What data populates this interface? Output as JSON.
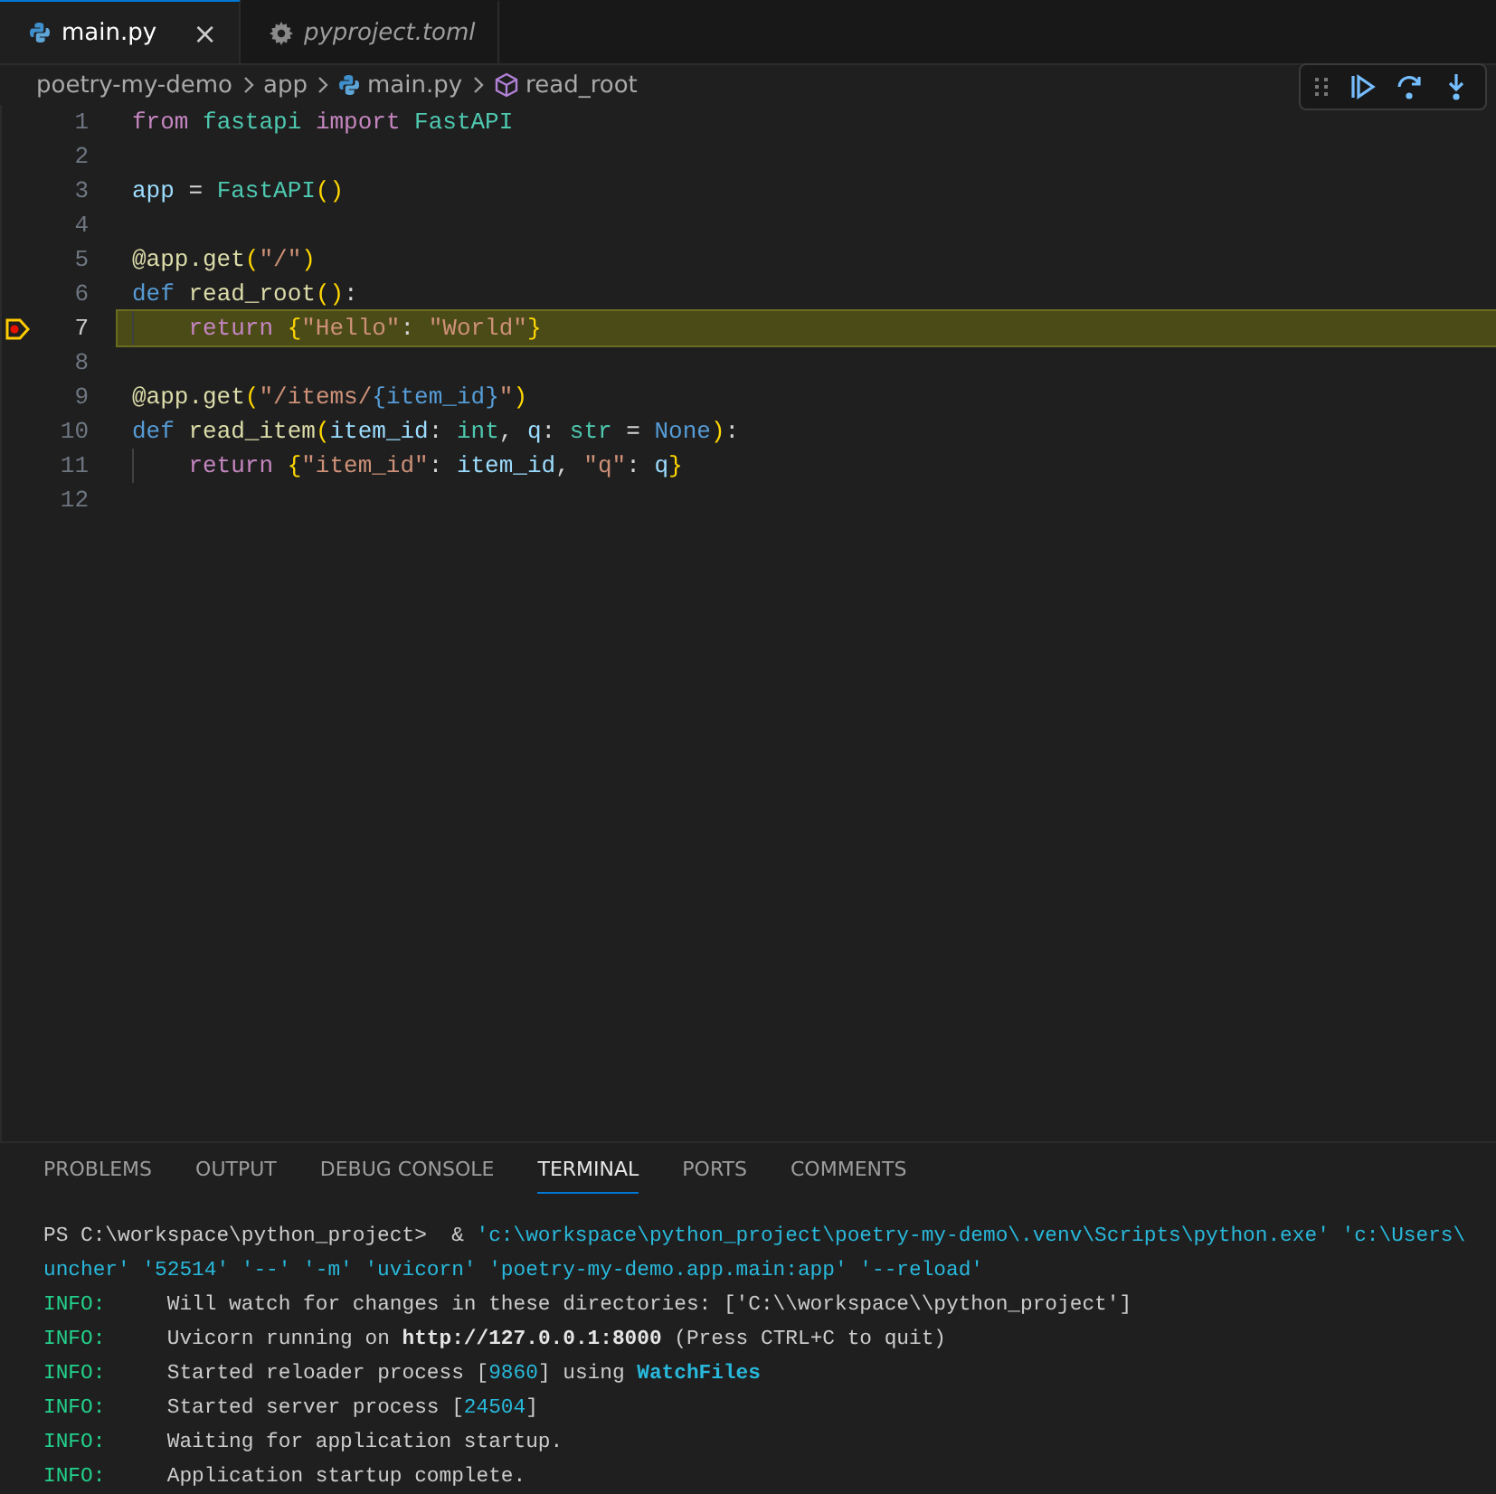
{
  "tabs": [
    {
      "label": "main.py",
      "kind": "python_file",
      "selected": true,
      "preview": false,
      "close": "×"
    },
    {
      "label": "pyproject.toml",
      "kind": "config_file",
      "selected": false,
      "preview": true
    }
  ],
  "breadcrumb": [
    {
      "label": "poetry-my-demo",
      "kind": "folder"
    },
    {
      "label": "app",
      "kind": "folder"
    },
    {
      "label": "main.py",
      "kind": "python_file"
    },
    {
      "label": "read_root",
      "kind": "function"
    }
  ],
  "debug_toolbar": [
    {
      "kind": "continue"
    },
    {
      "kind": "step-over"
    },
    {
      "kind": "step-into"
    }
  ],
  "editor": {
    "lines": [
      {
        "number": "1",
        "current": false,
        "indented": false,
        "tokens": [
          {
            "kind": "kw",
            "text": "from "
          },
          {
            "kind": "cls",
            "text": "fastapi "
          },
          {
            "kind": "kw",
            "text": "import "
          },
          {
            "kind": "cls",
            "text": "FastAPI"
          }
        ]
      },
      {
        "number": "2",
        "current": false,
        "indented": false
      },
      {
        "number": "3",
        "current": false,
        "indented": false,
        "tokens": [
          {
            "kind": "var",
            "text": "app"
          },
          {
            "kind": "plain",
            "text": " = "
          },
          {
            "kind": "cls",
            "text": "FastAPI"
          },
          {
            "kind": "br",
            "text": "()"
          }
        ]
      },
      {
        "number": "4",
        "current": false,
        "indented": false
      },
      {
        "number": "5",
        "current": false,
        "indented": false,
        "tokens": [
          {
            "kind": "fn",
            "text": "@app.get"
          },
          {
            "kind": "br",
            "text": "("
          },
          {
            "kind": "str",
            "text": "\"/\""
          },
          {
            "kind": "br",
            "text": ")"
          }
        ]
      },
      {
        "number": "6",
        "current": false,
        "indented": false,
        "tokens": [
          {
            "kind": "def",
            "text": "def "
          },
          {
            "kind": "fn",
            "text": "read_root"
          },
          {
            "kind": "br",
            "text": "()"
          },
          {
            "kind": "plain",
            "text": ":"
          }
        ]
      },
      {
        "number": "7",
        "current": true,
        "indented": true,
        "tokens": [
          {
            "kind": "kw",
            "text": "return "
          },
          {
            "kind": "br",
            "text": "{"
          },
          {
            "kind": "str",
            "text": "\"Hello\""
          },
          {
            "kind": "plain",
            "text": ": "
          },
          {
            "kind": "str",
            "text": "\"World\""
          },
          {
            "kind": "br",
            "text": "}"
          }
        ]
      },
      {
        "number": "8",
        "current": false,
        "indented": false
      },
      {
        "number": "9",
        "current": false,
        "indented": false,
        "tokens": [
          {
            "kind": "fn",
            "text": "@app.get"
          },
          {
            "kind": "br",
            "text": "("
          },
          {
            "kind": "str",
            "text": "\"/items/"
          },
          {
            "kind": "def",
            "text": "{item_id}"
          },
          {
            "kind": "str",
            "text": "\""
          },
          {
            "kind": "br",
            "text": ")"
          }
        ]
      },
      {
        "number": "10",
        "current": false,
        "indented": false,
        "tokens": [
          {
            "kind": "def",
            "text": "def "
          },
          {
            "kind": "fn",
            "text": "read_item"
          },
          {
            "kind": "br",
            "text": "("
          },
          {
            "kind": "var",
            "text": "item_id"
          },
          {
            "kind": "plain",
            "text": ": "
          },
          {
            "kind": "cls",
            "text": "int"
          },
          {
            "kind": "plain",
            "text": ", "
          },
          {
            "kind": "var",
            "text": "q"
          },
          {
            "kind": "plain",
            "text": ": "
          },
          {
            "kind": "cls",
            "text": "str"
          },
          {
            "kind": "plain",
            "text": " = "
          },
          {
            "kind": "def",
            "text": "None"
          },
          {
            "kind": "br",
            "text": ")"
          },
          {
            "kind": "plain",
            "text": ":"
          }
        ]
      },
      {
        "number": "11",
        "current": false,
        "indented": true,
        "tokens": [
          {
            "kind": "kw",
            "text": "return "
          },
          {
            "kind": "br",
            "text": "{"
          },
          {
            "kind": "str",
            "text": "\"item_id\""
          },
          {
            "kind": "plain",
            "text": ": "
          },
          {
            "kind": "var",
            "text": "item_id"
          },
          {
            "kind": "plain",
            "text": ", "
          },
          {
            "kind": "str",
            "text": "\"q\""
          },
          {
            "kind": "plain",
            "text": ": "
          },
          {
            "kind": "var",
            "text": "q"
          },
          {
            "kind": "br",
            "text": "}"
          }
        ]
      },
      {
        "number": "12",
        "current": false,
        "indented": false
      }
    ]
  },
  "panel": {
    "tabs": [
      {
        "label": "PROBLEMS",
        "selected": false
      },
      {
        "label": "OUTPUT",
        "selected": false
      },
      {
        "label": "DEBUG CONSOLE",
        "selected": false
      },
      {
        "label": "TERMINAL",
        "selected": true
      },
      {
        "label": "PORTS",
        "selected": false
      },
      {
        "label": "COMMENTS",
        "selected": false
      }
    ],
    "terminal": [
      [
        {
          "kind": "plain",
          "text": "PS C:\\workspace\\python_project>  & "
        },
        {
          "kind": "path",
          "text": "'c:\\workspace\\python_project\\poetry-my-demo\\.venv\\Scripts\\python.exe' 'c:\\Users\\"
        }
      ],
      [
        {
          "kind": "path",
          "text": "uncher' '52514' '--' '-m' 'uvicorn' 'poetry-my-demo.app.main:app' '--reload'"
        }
      ],
      [
        {
          "kind": "info",
          "text": "INFO:"
        },
        {
          "kind": "plain",
          "text": "     Will watch for changes in these directories: ['C:\\\\workspace\\\\python_project']"
        }
      ],
      [
        {
          "kind": "info",
          "text": "INFO:"
        },
        {
          "kind": "plain",
          "text": "     Uvicorn running on "
        },
        {
          "kind": "bold",
          "text": "http://127.0.0.1:8000"
        },
        {
          "kind": "plain",
          "text": " (Press CTRL+C to quit)"
        }
      ],
      [
        {
          "kind": "info",
          "text": "INFO:"
        },
        {
          "kind": "plain",
          "text": "     Started reloader process ["
        },
        {
          "kind": "num",
          "text": "9860"
        },
        {
          "kind": "plain",
          "text": "] using "
        },
        {
          "kind": "link",
          "text": "WatchFiles"
        }
      ],
      [
        {
          "kind": "info",
          "text": "INFO:"
        },
        {
          "kind": "plain",
          "text": "     Started server process ["
        },
        {
          "kind": "num",
          "text": "24504"
        },
        {
          "kind": "plain",
          "text": "]"
        }
      ],
      [
        {
          "kind": "info",
          "text": "INFO:"
        },
        {
          "kind": "plain",
          "text": "     Waiting for application startup."
        }
      ],
      [
        {
          "kind": "info",
          "text": "INFO:"
        },
        {
          "kind": "plain",
          "text": "     Application startup complete."
        }
      ]
    ]
  }
}
